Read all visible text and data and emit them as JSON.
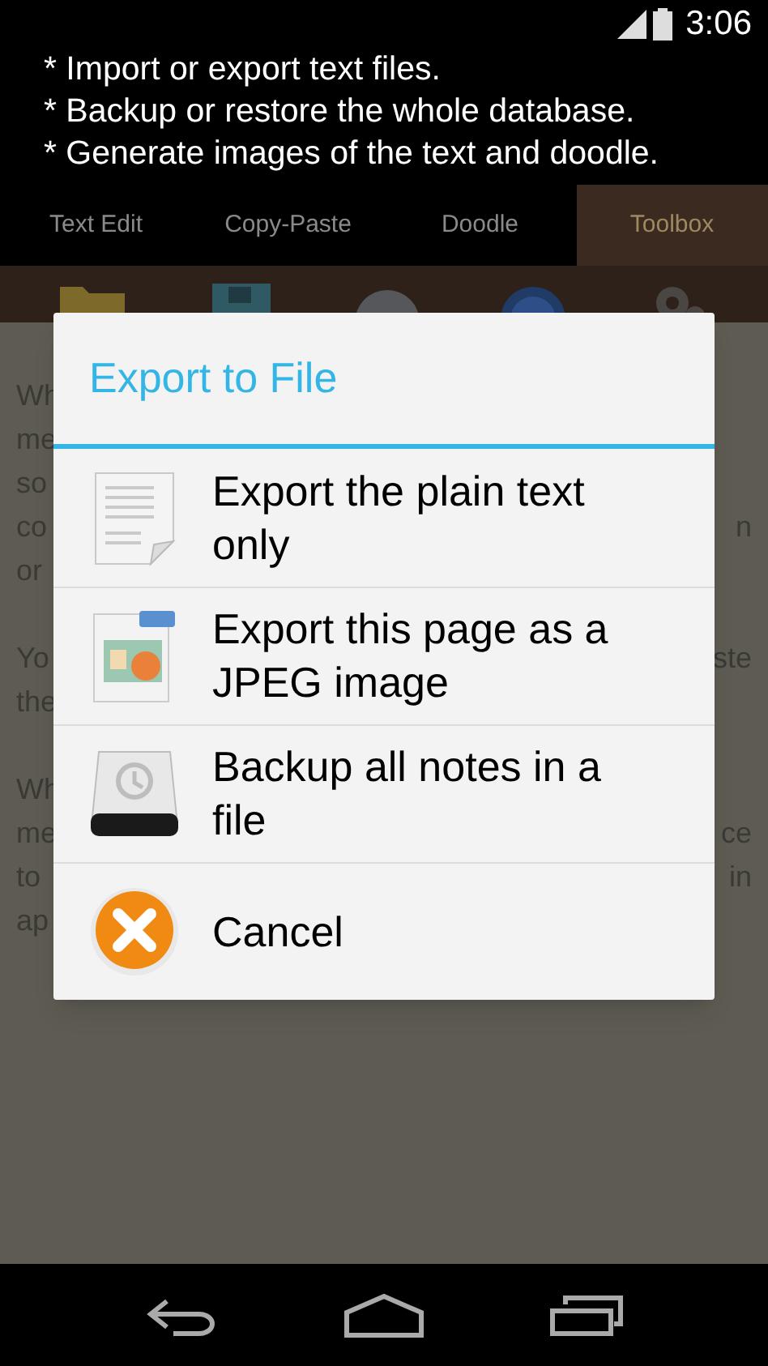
{
  "status_bar": {
    "time": "3:06"
  },
  "promo_lines": [
    "* Import or export text files.",
    "* Backup or restore the whole database.",
    "* Generate images of the text and doodle."
  ],
  "tabs": [
    {
      "label": "Text Edit",
      "selected": false
    },
    {
      "label": "Copy-Paste",
      "selected": false
    },
    {
      "label": "Doodle",
      "selected": false
    },
    {
      "label": "Toolbox",
      "selected": true
    }
  ],
  "background_lines": [
    {
      "left": "Wh"
    },
    {
      "left": "me"
    },
    {
      "left": "so"
    },
    {
      "left": "co",
      "right": "n"
    },
    {
      "left": "or"
    },
    {
      "gap": true
    },
    {
      "left": "Yo",
      "right": "ste"
    },
    {
      "left": "the"
    },
    {
      "gap": true
    },
    {
      "left": "Wh"
    },
    {
      "left": "me",
      "right": "ce"
    },
    {
      "left": "to",
      "right": "in"
    },
    {
      "left": "ap"
    }
  ],
  "dialog": {
    "title": "Export to File",
    "items": [
      {
        "kind": "text",
        "label": "Export the plain text only"
      },
      {
        "kind": "jpeg",
        "label": "Export this page as a JPEG image"
      },
      {
        "kind": "backup",
        "label": "Backup all notes in a file"
      },
      {
        "kind": "cancel",
        "label": "Cancel"
      }
    ]
  }
}
